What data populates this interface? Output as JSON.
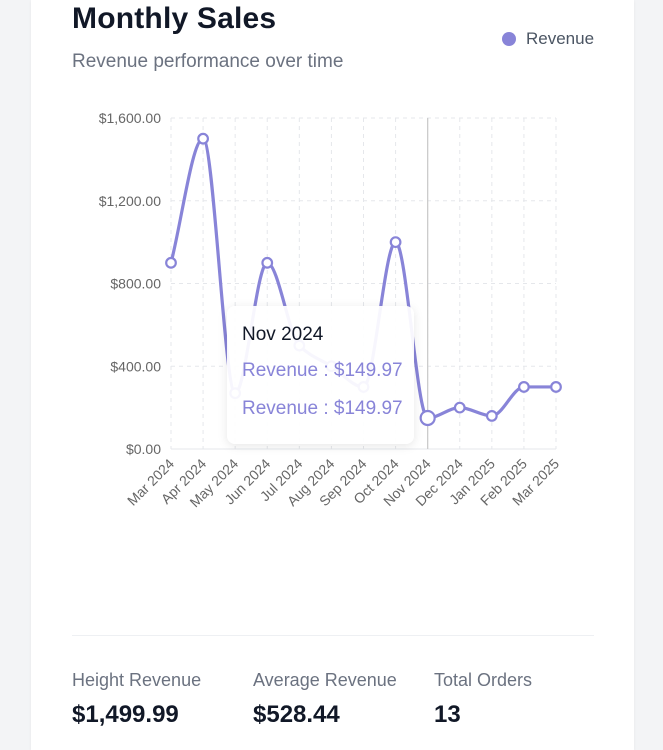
{
  "header": {
    "title": "Monthly Sales",
    "subtitle": "Revenue performance over time",
    "legend_label": "Revenue"
  },
  "colors": {
    "series": "#8884d8",
    "grid": "#e5e7eb",
    "axis_text": "#666666",
    "cursor": "#cccccc"
  },
  "chart_data": {
    "type": "line",
    "title": "Monthly Sales",
    "subtitle": "Revenue performance over time",
    "xlabel": "",
    "ylabel": "",
    "categories": [
      "Mar 2024",
      "Apr 2024",
      "May 2024",
      "Jun 2024",
      "Jul 2024",
      "Aug 2024",
      "Sep 2024",
      "Oct 2024",
      "Nov 2024",
      "Dec 2024",
      "Jan 2025",
      "Feb 2025",
      "Mar 2025"
    ],
    "series": [
      {
        "name": "Revenue",
        "values": [
          899.97,
          1499.99,
          269.97,
          899.97,
          499.98,
          399.98,
          299.99,
          999.99,
          149.97,
          199.98,
          159.98,
          299.98,
          299.98
        ]
      }
    ],
    "ylim": [
      0,
      1600
    ],
    "yticks": [
      0,
      400,
      800,
      1200,
      1600
    ],
    "ytick_labels": [
      "$0.00",
      "$400.00",
      "$800.00",
      "$1,200.00",
      "$1,600.00"
    ],
    "grid": true,
    "legend_position": "top-right",
    "active_index": 8
  },
  "tooltip": {
    "title": "Nov 2024",
    "rows": [
      "Revenue : $149.97",
      "Revenue : $149.97"
    ]
  },
  "stats": [
    {
      "label": "Height Revenue",
      "value": "$1,499.99"
    },
    {
      "label": "Average Revenue",
      "value": "$528.44"
    },
    {
      "label": "Total Orders",
      "value": "13"
    }
  ]
}
